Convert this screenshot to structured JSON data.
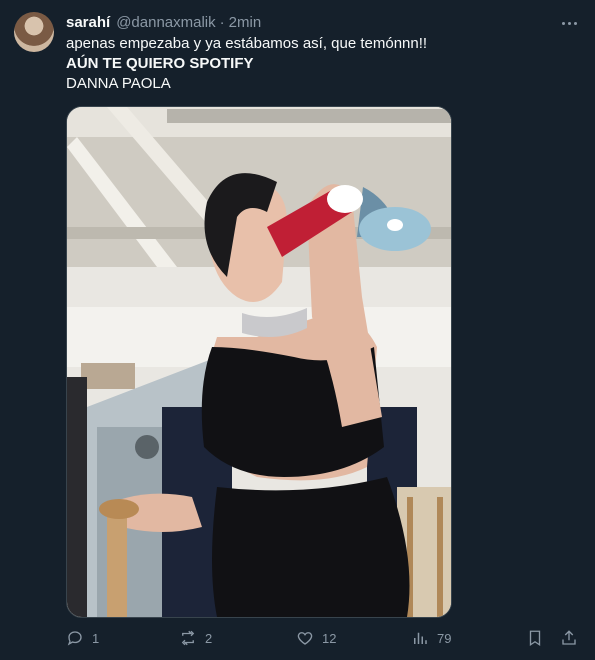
{
  "tweet": {
    "display_name": "sarahí",
    "handle": "@dannaxmalik",
    "separator": "·",
    "time": "2min",
    "lines": [
      "apenas empezaba y ya estábamos así, que temónnn!!",
      "AÚN TE QUIERO SPOTIFY",
      "DANNA PAOLA"
    ]
  },
  "actions": {
    "replies": "1",
    "retweets": "2",
    "likes": "12",
    "views": "79"
  },
  "colors": {
    "background": "#15202b",
    "text": "#f7f9f9",
    "secondary": "#8b98a5",
    "border": "#38444d"
  }
}
